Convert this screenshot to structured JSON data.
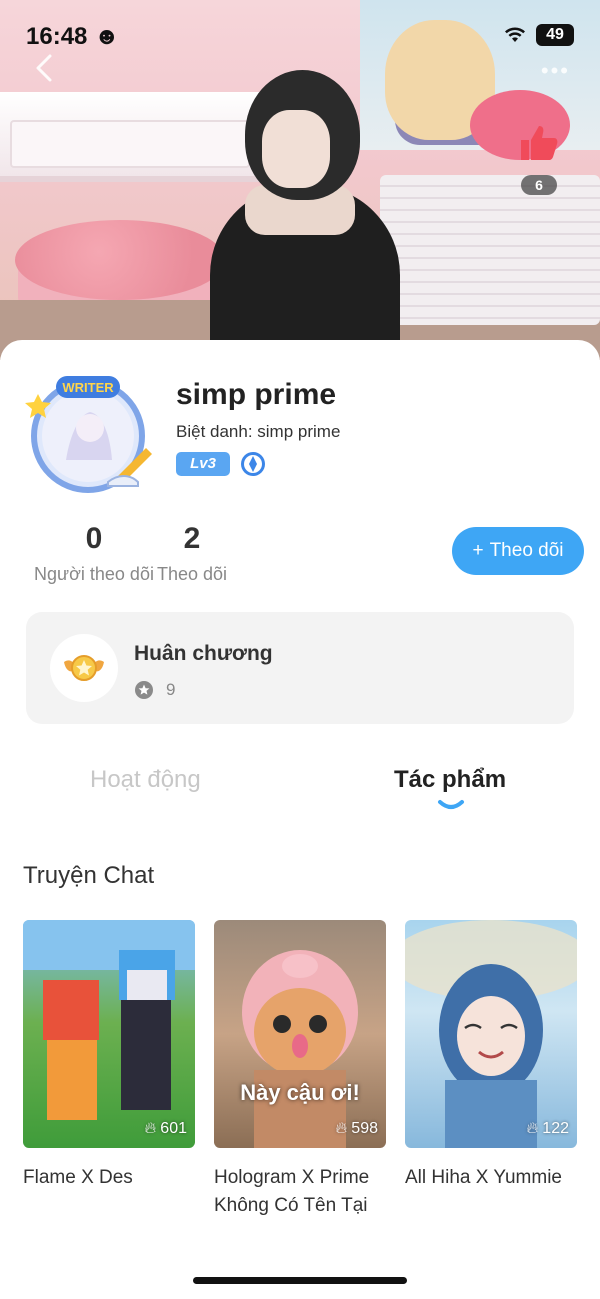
{
  "status_bar": {
    "time": "16:48",
    "battery": "49"
  },
  "header": {
    "like_count": "6"
  },
  "profile": {
    "username": "simp prime",
    "nickname": "Biệt danh: simp prime",
    "level": "Lv3",
    "avatar_frame_text": "WRITER"
  },
  "stats": {
    "followers_count": "0",
    "followers_label": "Người theo dõi",
    "following_count": "2",
    "following_label": "Theo dõi"
  },
  "follow_button": {
    "label": "Theo dõi"
  },
  "medals": {
    "title": "Huân chương",
    "count": "9"
  },
  "tabs": [
    {
      "label": "Hoạt động",
      "active": false
    },
    {
      "label": "Tác phẩm",
      "active": true
    }
  ],
  "section": {
    "title": "Truyện Chat"
  },
  "stories": [
    {
      "title": "Flame X Des",
      "views": "601",
      "caption": ""
    },
    {
      "title": "Hologram X Prime Không Có Tên Tại",
      "views": "598",
      "caption": "Này cậu ơi!"
    },
    {
      "title": "All Hiha X Yummie",
      "views": "122",
      "caption": ""
    }
  ],
  "colors": {
    "accent": "#3ea6f5",
    "level_badge": "#5aa6f2",
    "like": "#f04b5a"
  }
}
